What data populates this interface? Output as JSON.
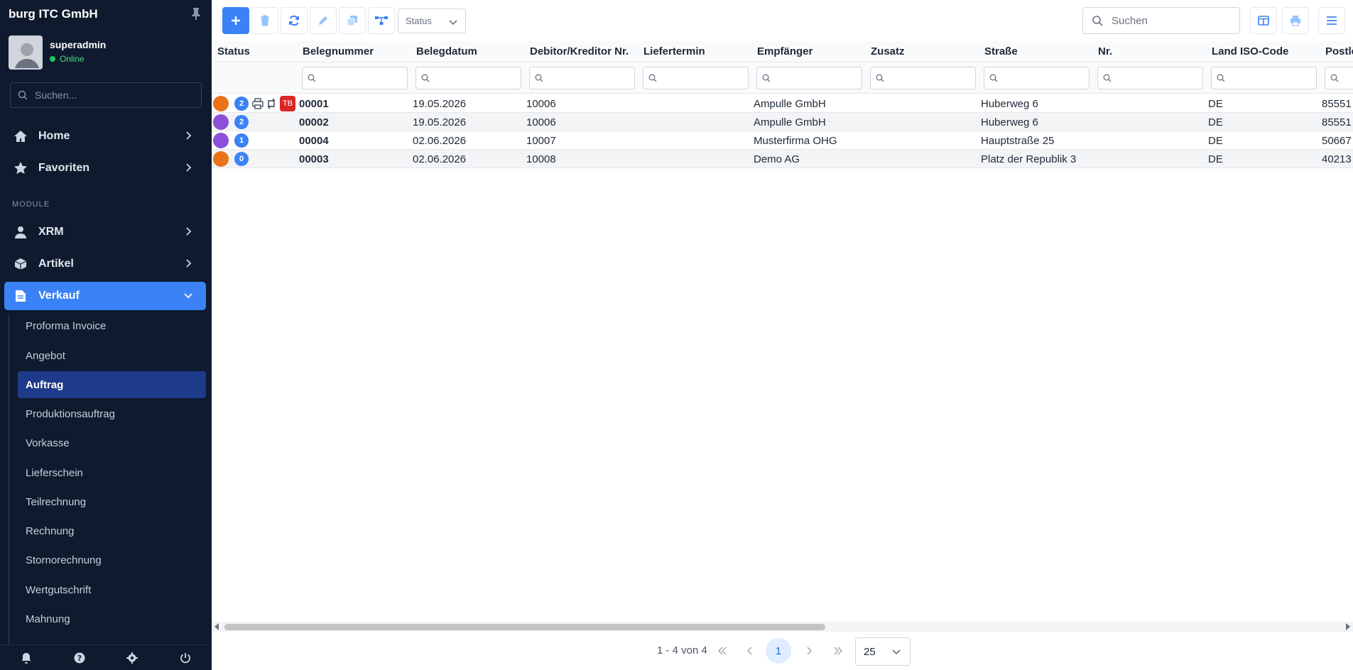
{
  "sidebar": {
    "brand": "burg ITC GmbH",
    "user": {
      "name": "superadmin",
      "status": "Online"
    },
    "search_placeholder": "Suchen...",
    "top_items": [
      {
        "label": "Home",
        "icon": "home-icon"
      },
      {
        "label": "Favoriten",
        "icon": "star-icon"
      }
    ],
    "section_label": "MODULE",
    "module_items": [
      {
        "label": "XRM",
        "icon": "user-icon"
      },
      {
        "label": "Artikel",
        "icon": "box-icon"
      },
      {
        "label": "Verkauf",
        "icon": "document-icon",
        "active": true
      }
    ],
    "sub_items": [
      {
        "label": "Proforma Invoice"
      },
      {
        "label": "Angebot"
      },
      {
        "label": "Auftrag",
        "active": true
      },
      {
        "label": "Produktionsauftrag"
      },
      {
        "label": "Vorkasse"
      },
      {
        "label": "Lieferschein"
      },
      {
        "label": "Teilrechnung"
      },
      {
        "label": "Rechnung"
      },
      {
        "label": "Stornorechnung"
      },
      {
        "label": "Wertgutschrift"
      },
      {
        "label": "Mahnung"
      }
    ],
    "footer_icons": [
      "bell-icon",
      "help-icon",
      "settings-icon",
      "power-icon"
    ]
  },
  "toolbar": {
    "buttons": [
      "add-icon",
      "delete-icon",
      "refresh-icon",
      "edit-icon",
      "copy-icon",
      "workflow-icon"
    ],
    "status_label": "Status",
    "search_placeholder": "Suchen",
    "right_buttons": [
      "columns-icon",
      "print-icon",
      "menu-icon"
    ]
  },
  "grid": {
    "columns": [
      "Status",
      "Belegnummer",
      "Belegdatum",
      "Debitor/Kreditor Nr.",
      "Liefertermin",
      "Empfänger",
      "Zusatz",
      "Straße",
      "Nr.",
      "Land ISO-Code",
      "Postle"
    ],
    "rows": [
      {
        "status_color": "#ea7317",
        "badge": "2",
        "print": true,
        "sync": true,
        "tag": "TB",
        "belegnummer": "00001",
        "belegdatum": "19.05.2026",
        "debitor": "10006",
        "liefertermin": "",
        "empfaenger": "Ampulle GmbH",
        "zusatz": "",
        "strasse": "Huberweg 6",
        "nr": "",
        "land": "DE",
        "plz": "85551"
      },
      {
        "status_color": "#8b4fd8",
        "badge": "2",
        "print": false,
        "sync": false,
        "tag": "",
        "belegnummer": "00002",
        "belegdatum": "19.05.2026",
        "debitor": "10006",
        "liefertermin": "",
        "empfaenger": "Ampulle GmbH",
        "zusatz": "",
        "strasse": "Huberweg 6",
        "nr": "",
        "land": "DE",
        "plz": "85551"
      },
      {
        "status_color": "#8b4fd8",
        "badge": "1",
        "print": false,
        "sync": false,
        "tag": "",
        "belegnummer": "00004",
        "belegdatum": "02.06.2026",
        "debitor": "10007",
        "liefertermin": "",
        "empfaenger": "Musterfirma OHG",
        "zusatz": "",
        "strasse": "Hauptstraße 25",
        "nr": "",
        "land": "DE",
        "plz": "50667"
      },
      {
        "status_color": "#ea7317",
        "badge": "0",
        "print": false,
        "sync": false,
        "tag": "",
        "belegnummer": "00003",
        "belegdatum": "02.06.2026",
        "debitor": "10008",
        "liefertermin": "",
        "empfaenger": "Demo AG",
        "zusatz": "",
        "strasse": "Platz der Republik 3",
        "nr": "",
        "land": "DE",
        "plz": "40213"
      }
    ]
  },
  "pager": {
    "info": "1 - 4 von 4",
    "current_page": "1",
    "page_size": "25"
  },
  "colors": {
    "sidebar_bg": "#0f1a2e",
    "accent": "#3b82f6",
    "active_sub": "#1e3a8a"
  }
}
